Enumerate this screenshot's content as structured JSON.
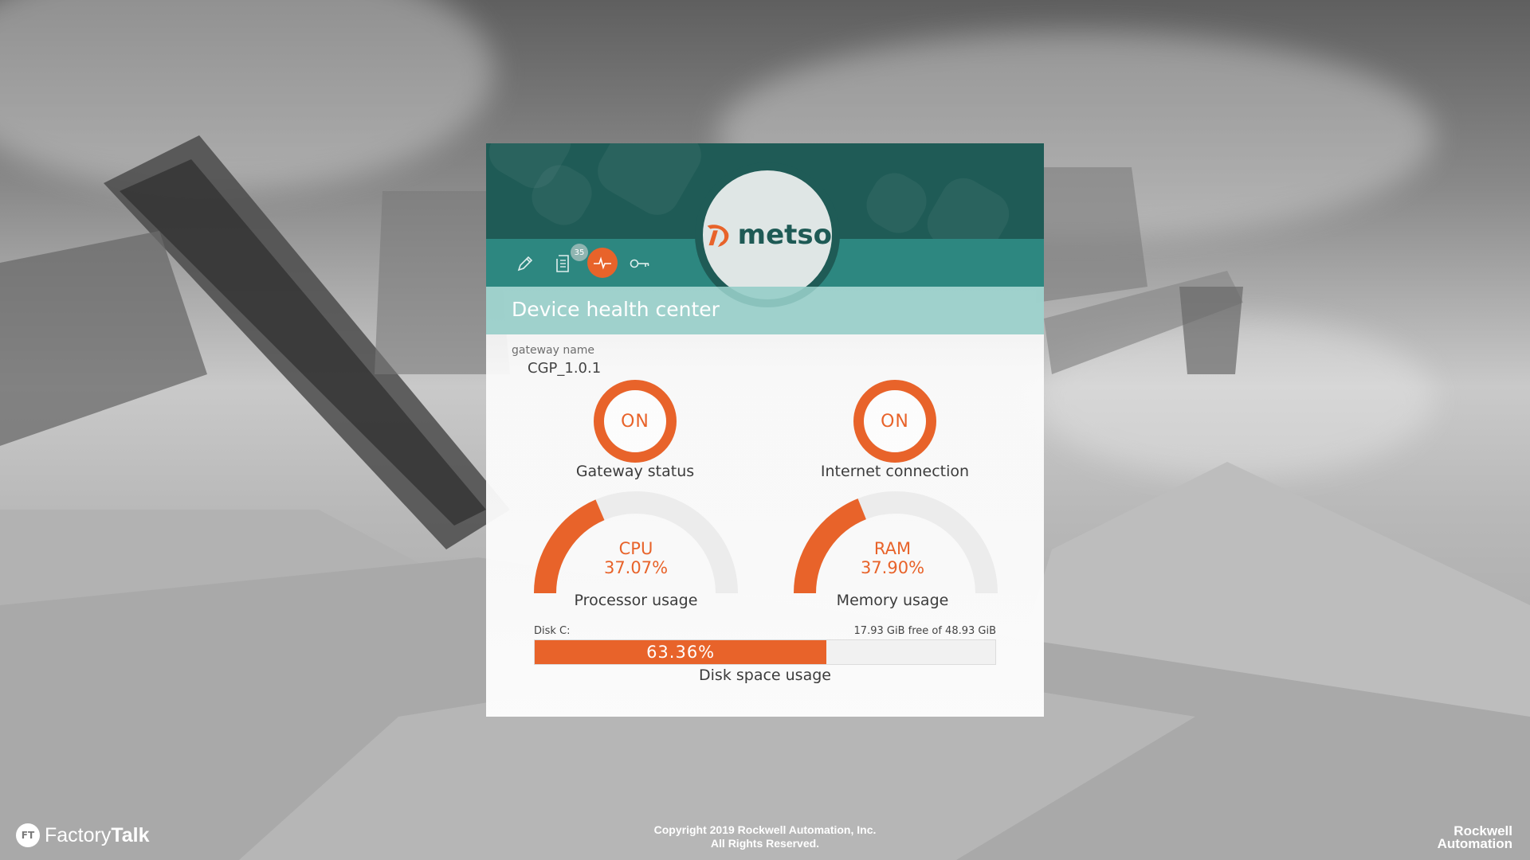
{
  "app": {
    "title": "Device health center",
    "brand": "metso"
  },
  "toolbar": {
    "items": [
      {
        "name": "edit",
        "icon": "pencil-icon"
      },
      {
        "name": "logs",
        "icon": "document-list-icon",
        "badge": "35"
      },
      {
        "name": "health",
        "icon": "heartbeat-icon",
        "active": true
      },
      {
        "name": "license",
        "icon": "key-icon"
      }
    ]
  },
  "gateway": {
    "label": "gateway name",
    "value": "CGP_1.0.1"
  },
  "status": {
    "gateway": {
      "value": "ON",
      "caption": "Gateway status"
    },
    "internet": {
      "value": "ON",
      "caption": "Internet connection"
    }
  },
  "gauges": {
    "cpu": {
      "title": "CPU",
      "value_text": "37.07%",
      "value": 37.07,
      "caption": "Processor usage"
    },
    "ram": {
      "title": "RAM",
      "value_text": "37.90%",
      "value": 37.9,
      "caption": "Memory usage"
    }
  },
  "disk": {
    "label": "Disk C:",
    "free_text": "17.93 GiB free of 48.93 GiB",
    "percent_text": "63.36%",
    "percent": 63.36,
    "caption": "Disk space usage"
  },
  "footer": {
    "factorytalk_badge": "FT",
    "factorytalk_text_1": "Factory",
    "factorytalk_text_2": "Talk",
    "copyright_line1": "Copyright 2019 Rockwell Automation, Inc.",
    "copyright_line2": "All Rights Reserved.",
    "rockwell_line1": "Rockwell",
    "rockwell_line2": "Automation"
  },
  "colors": {
    "accent": "#e8632a",
    "header_dark": "#1f5b56",
    "toolbar": "#2d8780",
    "title_bar": "#96cdc8"
  }
}
